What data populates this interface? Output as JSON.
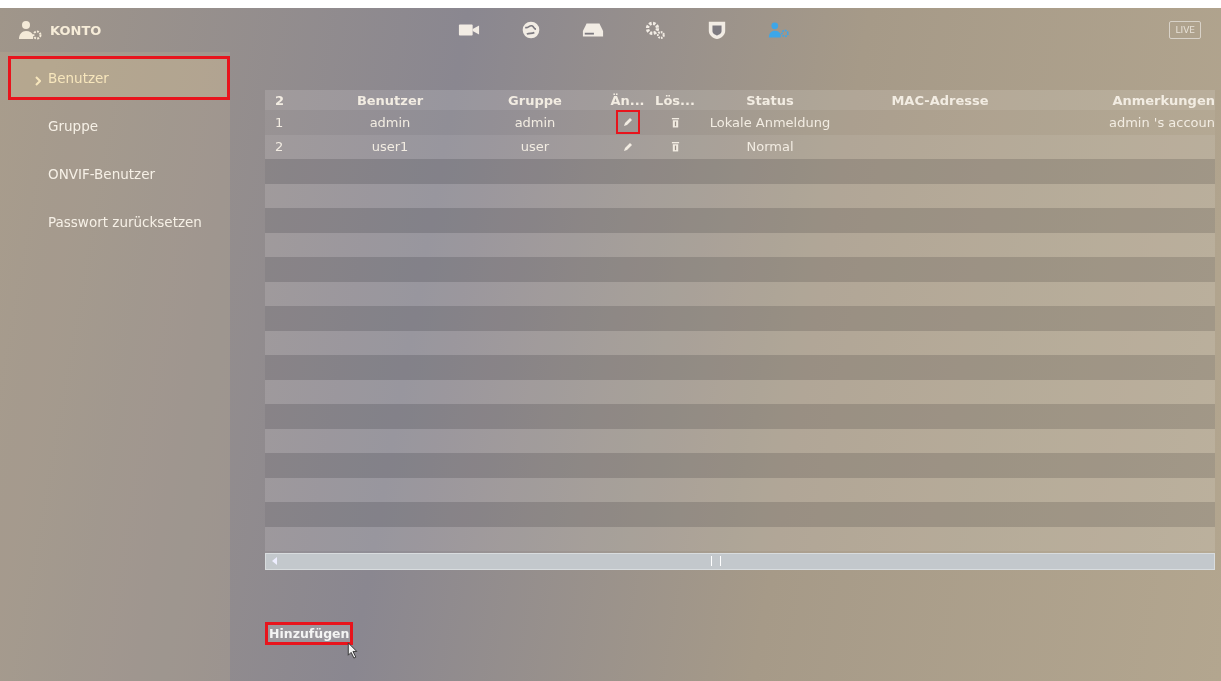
{
  "header": {
    "title": "KONTO",
    "icons": [
      {
        "kind": "camera",
        "selected": false
      },
      {
        "kind": "globe",
        "selected": false
      },
      {
        "kind": "storage",
        "selected": false
      },
      {
        "kind": "gears",
        "selected": false
      },
      {
        "kind": "shield",
        "selected": false
      },
      {
        "kind": "user",
        "selected": true
      }
    ],
    "live": "LIVE"
  },
  "sidebar": {
    "items": [
      {
        "label": "Benutzer",
        "selected": true,
        "highlighted": true
      },
      {
        "label": "Gruppe",
        "selected": false,
        "highlighted": false
      },
      {
        "label": "ONVIF-Benutzer",
        "selected": false,
        "highlighted": false
      },
      {
        "label": "Passwort zurücksetzen",
        "selected": false,
        "highlighted": false
      }
    ]
  },
  "table": {
    "columns": [
      "2",
      "Benutzer",
      "Gruppe",
      "Än...",
      "Lös...",
      "Status",
      "MAC-Adresse",
      "Anmerkungen"
    ],
    "rows": [
      {
        "index": "1",
        "user": "admin",
        "group": "admin",
        "edit_highlighted": true,
        "status": "Lokale Anmeldung",
        "remarks": "admin 's accoun"
      },
      {
        "index": "2",
        "user": "user1",
        "group": "user",
        "edit_highlighted": false,
        "status": "Normal",
        "remarks": ""
      }
    ]
  },
  "add_button": {
    "label": "Hinzufügen",
    "highlighted": true
  }
}
